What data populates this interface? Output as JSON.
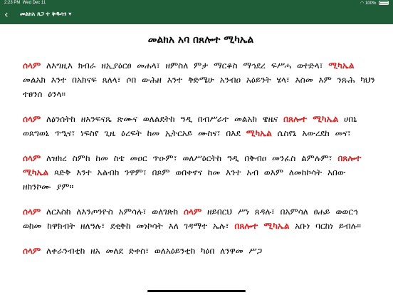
{
  "status_bar": {
    "time": "2:23 PM",
    "date": "Wed Dec 11",
    "battery": "100%",
    "icons": [
      "wifi-icon",
      "battery-icon"
    ]
  },
  "nav": {
    "back_icon": "‹",
    "title": "መልክአ ጸጋ ተ ቅዱሳን ▾"
  },
  "title": "መልክአ አባ በጸሎተ ሚካኤል",
  "paragraphs": [
    [
      {
        "t": "ሰላም",
        "red": true
      },
      {
        "t": " ለእግዚእ ክብራ ዘኢያዕርፀ መሐላ፣ ዘምስለ ምታ ማርቆስ ማኅደረ ፍሥሓ ወተድላ፣ "
      },
      {
        "t": "ሚካኤል",
        "red": true
      },
      {
        "t": " መልአክ እንተ በአክናፍ ጸለላ፣ ሶበ ውሕዘ እንተ ቅድሜሁ አንብዐ አዕይንት ሄላ፣ እስመ እም ንጹሕ ካህን ተፀንሰ ዕንላ።"
      }
    ],
    [
      {
        "t": "ሰላም",
        "red": true
      },
      {
        "t": " ለፅንሰትከ ዘእንፍናጼ ጽሙና ወለልደትከ ዓዲ በብሥራተ መልአክ ዌዜና "
      },
      {
        "t": "በጸሎተ ሚካኤል",
        "red": true
      },
      {
        "t": " ሀበኒ ወጸግወኒ ጥዒና፣ ነፍስየ ጊዜ ዕረፍት ከመ ኢትርአይ ሙስና፣ በእደ "
      },
      {
        "t": "ሚካኤል",
        "red": true
      },
      {
        "t": " ሴስየኒ አውረደከ መና፣"
      }
    ],
    [
      {
        "t": "ሰላም",
        "red": true
      },
      {
        "t": " ለዝክረ ስምከ ከመ ስቴ መዐር ጥዑም፣ ወለሥዕርትከ ዓዲ በቅብዐ መንፈስ ልምሉም፣ "
      },
      {
        "t": "በጸሎተ ሚካኤል",
        "red": true
      },
      {
        "t": " ጻድቅ እንተ አልብከ ንዋም፣ በጾም ወበቀኖና ከመ እንተ አብ ወእም ለመከኮሳት አበው ዘከንኮሙ ያም።"
      }
    ],
    [
      {
        "t": "ሰላም",
        "red": true
      },
      {
        "t": " ለርእስከ ለእንጦንዮስ አምሳሉ፣ ወለገጽከ "
      },
      {
        "t": "ሰላም",
        "red": true
      },
      {
        "t": " ዘይበርህ ሥነ ጸዳሉ፣ በአምሳለ ፀሐይ ወወርኅ ወከመ ከዋክብት ዘለዓሉ፣ ደቂቅከ መነኮሳት እለ ገዳማተ ኤሉ፣ "
      },
      {
        "t": "በጸሎተ ሚካኤል",
        "red": true
      },
      {
        "t": " አቡነ ባርከነ ይብሉ።"
      }
    ],
    [
      {
        "t": "ሰላም",
        "red": true
      },
      {
        "t": " ለቀራንብቲከ ዘአ መለደ ድቀስ፣ ወለአዕይንቲከ ካዕበ ለንዋመ ሥጋ"
      }
    ]
  ]
}
